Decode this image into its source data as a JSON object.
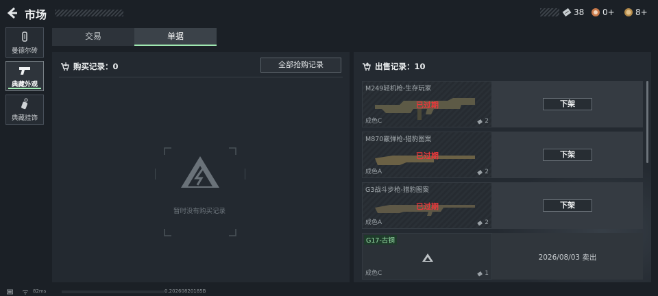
{
  "header": {
    "title": "市场",
    "currencies": [
      {
        "icon": "bond-ticket-icon",
        "value": "38"
      },
      {
        "icon": "emblem-coin-icon",
        "value": "0+"
      },
      {
        "icon": "gold-coin-icon",
        "value": "8+"
      }
    ]
  },
  "sidebar": {
    "items": [
      {
        "label": "曼德尔砖",
        "icon": "mandel-brick-icon",
        "active": false
      },
      {
        "label": "典藏外观",
        "icon": "pistol-icon",
        "active": true
      },
      {
        "label": "典藏挂饰",
        "icon": "charm-icon",
        "active": false
      }
    ]
  },
  "tabs": [
    {
      "label": "交易",
      "active": false
    },
    {
      "label": "单据",
      "active": true
    }
  ],
  "buy": {
    "header": "购买记录：0",
    "all_button": "全部抢购记录",
    "empty_text": "暂时没有购买记录"
  },
  "sell": {
    "header": "出售记录：10",
    "records": [
      {
        "name": "M249轻机枪-生存玩家",
        "condition": "成色C",
        "qty": "2",
        "status": "已过期",
        "action": "下架"
      },
      {
        "name": "M870霰弹枪-猎豹图案",
        "condition": "成色A",
        "qty": "2",
        "status": "已过期",
        "action": "下架"
      },
      {
        "name": "G3战斗步枪-猎豹图案",
        "condition": "成色A",
        "qty": "2",
        "status": "已过期",
        "action": "下架"
      },
      {
        "name": "G17-古铜",
        "condition": "成色C",
        "qty": "1",
        "sold_text": "2026/08/03 卖出"
      }
    ]
  },
  "footer": {
    "ping": "82ms",
    "build": "0.20260820185B"
  },
  "colors": {
    "accent_green": "#a6efb7",
    "expired_red": "#e8383b",
    "background": "#1b2026"
  }
}
